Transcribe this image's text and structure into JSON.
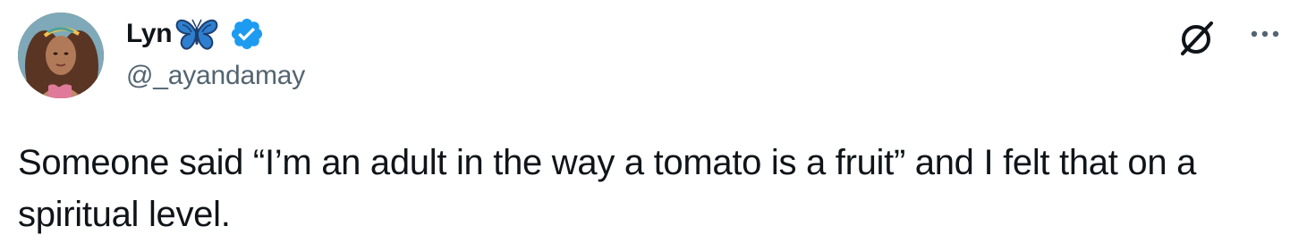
{
  "author": {
    "display_name": "Lyn",
    "name_emoji": "butterfly-emoji",
    "verified_badge": "verified-badge-icon",
    "handle": "@_ayandamay",
    "avatar": "profile-photo"
  },
  "actions": {
    "grok_icon": "grok-icon",
    "more_icon": "more-options-icon"
  },
  "tweet": {
    "text": "Someone said “I’m an adult in the way a tomato is a fruit” and I felt that on a spiritual level."
  },
  "colors": {
    "text_primary": "#0f1419",
    "text_secondary": "#536471",
    "verified_blue": "#1d9bf0",
    "butterfly_blue": "#3a8fd9"
  }
}
